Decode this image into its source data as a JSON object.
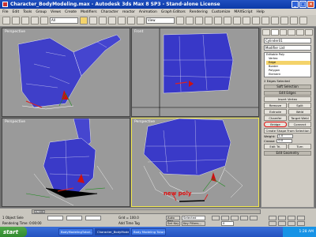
{
  "window": {
    "title": "Character_BodyModeling.max - Autodesk 3ds Max 8 SP3 - Stand-alone License",
    "minimize": "_",
    "maximize": "□",
    "close": "×"
  },
  "menubar": [
    "File",
    "Edit",
    "Tools",
    "Group",
    "Views",
    "Create",
    "Modifiers",
    "Character",
    "reactor",
    "Animation",
    "Graph Editors",
    "Rendering",
    "Customize",
    "MAXScript",
    "Help"
  ],
  "toolbar": {
    "selection_filter": "All",
    "view_dropdown": "View"
  },
  "viewports": {
    "top_left": "Perspective",
    "top_right": "Front",
    "bottom_left": "Perspective",
    "bottom_right": "Perspective"
  },
  "annotation": "new poly",
  "command_panel": {
    "object_name": "Cylinder01",
    "modifier_list": "Modifier List",
    "stack": [
      "Editable Poly",
      "Vertex",
      "Edge",
      "Border",
      "Polygon",
      "Element"
    ],
    "stack_selected": "Edge",
    "edges_selected": "2 Edges Selected",
    "soft_selection": "Soft Selection",
    "edit_edges": "Edit Edges",
    "insert_vertex": "Insert Vertex",
    "remove": "Remove",
    "split": "Split",
    "extrude": "Extrude",
    "weld": "Weld",
    "chamfer": "Chamfer",
    "target_weld": "Target Weld",
    "bridge": "Bridge",
    "connect": "Connect",
    "create_shape": "Create Shape From Selection",
    "weight_label": "Weight:",
    "weight_value": "1.0",
    "crease_label": "Crease:",
    "crease_value": "0.0",
    "edit_tri": "Edit Tri.",
    "turn": "Turn",
    "edit_geometry": "Edit Geometry"
  },
  "status": {
    "selected": "1 Object Sele",
    "rendering_time": "Rendering Time: 0:00:00",
    "grid": "Grid = 100.0",
    "add_time_tag": "Add Time Tag",
    "auto_key": "Auto Key",
    "selected_dropdown": "Selected",
    "set_key": "Set Key",
    "key_filters": "Key Filters...",
    "frame": "0",
    "timeline": "0 / 100"
  },
  "taskbar": {
    "start": "start",
    "tasks": [
      "BodyModelingTutori...",
      "Character_BodyMode...",
      "Body Modeling Tutori..."
    ],
    "clock": "1:28 AM"
  }
}
